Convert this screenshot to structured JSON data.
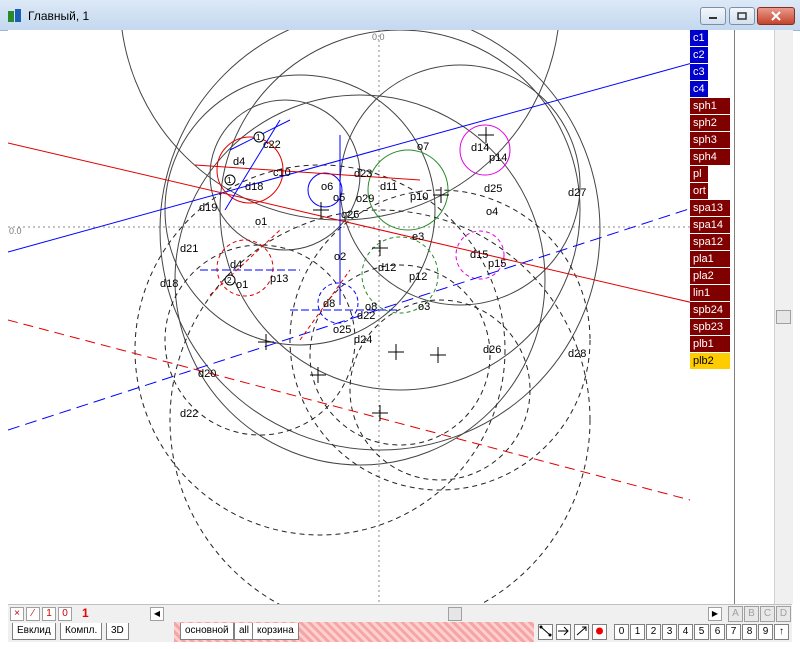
{
  "window": {
    "title": "Главный, 1"
  },
  "layers": [
    {
      "label": "c1",
      "bg": "#0000cc",
      "fg": "#ffffff"
    },
    {
      "label": "c2",
      "bg": "#0000cc",
      "fg": "#ffffff"
    },
    {
      "label": "c3",
      "bg": "#0000cc",
      "fg": "#ffffff"
    },
    {
      "label": "c4",
      "bg": "#0000cc",
      "fg": "#ffffff"
    },
    {
      "label": "sph1",
      "bg": "#800000",
      "fg": "#ffffff"
    },
    {
      "label": "sph2",
      "bg": "#800000",
      "fg": "#ffffff"
    },
    {
      "label": "sph3",
      "bg": "#800000",
      "fg": "#ffffff"
    },
    {
      "label": "sph4",
      "bg": "#800000",
      "fg": "#ffffff"
    },
    {
      "label": "pl",
      "bg": "#800000",
      "fg": "#ffffff"
    },
    {
      "label": "ort",
      "bg": "#800000",
      "fg": "#ffffff"
    },
    {
      "label": "spa13",
      "bg": "#800000",
      "fg": "#ffffff"
    },
    {
      "label": "spa14",
      "bg": "#800000",
      "fg": "#ffffff"
    },
    {
      "label": "spa12",
      "bg": "#800000",
      "fg": "#ffffff"
    },
    {
      "label": "pla1",
      "bg": "#800000",
      "fg": "#ffffff"
    },
    {
      "label": "pla2",
      "bg": "#800000",
      "fg": "#ffffff"
    },
    {
      "label": "lin1",
      "bg": "#800000",
      "fg": "#ffffff"
    },
    {
      "label": "spb24",
      "bg": "#800000",
      "fg": "#ffffff"
    },
    {
      "label": "spb23",
      "bg": "#800000",
      "fg": "#ffffff"
    },
    {
      "label": "plb1",
      "bg": "#800000",
      "fg": "#ffffff"
    },
    {
      "label": "plb2",
      "bg": "#ffcc00",
      "fg": "#000000"
    }
  ],
  "axis": {
    "origin_x_label": "0.0",
    "origin_y_label": "0.0"
  },
  "drawing_labels": [
    "c22",
    "d4",
    "d18",
    "c10",
    "o6",
    "d23",
    "d11",
    "p10",
    "o7",
    "d14",
    "p14",
    "d25",
    "d27",
    "d19",
    "o5",
    "o29",
    "o26",
    "o1",
    "o4",
    "e3",
    "d21",
    "o2",
    "d15",
    "p15",
    "d12",
    "p12",
    "d18",
    "d4",
    "p13",
    "o1",
    "o3",
    "o25",
    "d8",
    "d22",
    "o8",
    "d24",
    "d26",
    "d28",
    "d20",
    "d22",
    "1",
    "1",
    "2"
  ],
  "status_bar": {
    "x_btn": "×",
    "line_btn": "⁄",
    "one_btn": "1",
    "zero_btn": "0",
    "step": "1",
    "tabs": [
      "Евклид",
      "Компл.",
      "3D"
    ],
    "layer_tabs": [
      "основной",
      "all",
      "корзина"
    ],
    "num_buttons": [
      "0",
      "1",
      "2",
      "3",
      "4",
      "5",
      "6",
      "7",
      "8",
      "9",
      "↑"
    ],
    "letters": [
      "A",
      "B",
      "C",
      "D"
    ]
  },
  "colors": {
    "blue": "#0000ff",
    "red": "#ff0000",
    "green": "#008000",
    "magenta": "#ff00ff"
  }
}
